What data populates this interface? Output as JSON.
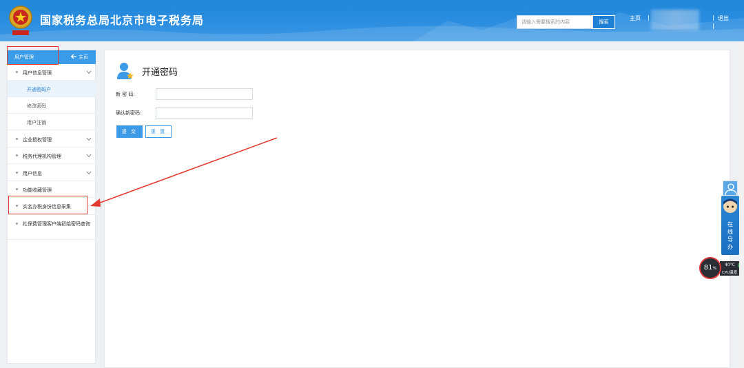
{
  "header": {
    "site_title": "国家税务总局北京市电子税务局",
    "search_placeholder": "请输入需要搜索的内容",
    "search_button": "搜索",
    "home_link": "主页",
    "separator": "|",
    "logout_link": "退出"
  },
  "sidebar": {
    "title": "用户管理",
    "home_link": "主页",
    "items": [
      {
        "label": "用户信息管理",
        "expandable": true
      },
      {
        "label": "开通密码户",
        "sub": true,
        "active": true
      },
      {
        "label": "修改密码",
        "sub": true
      },
      {
        "label": "用户注销",
        "sub": true
      },
      {
        "label": "企业授权管理",
        "expandable": true
      },
      {
        "label": "税务代理机构管理",
        "expandable": true
      },
      {
        "label": "用户信息",
        "expandable": true
      },
      {
        "label": "功能收藏管理",
        "expandable": false
      },
      {
        "label": "实名办税身份信息采集",
        "expandable": false
      },
      {
        "label": "社保费管理客户端初始密码查询",
        "expandable": false
      }
    ]
  },
  "main": {
    "page_title": "开通密码",
    "fields": [
      {
        "label": "新 密 码:",
        "value": ""
      },
      {
        "label": "确认新密码:",
        "value": ""
      }
    ],
    "submit_button": "提 交",
    "reset_button": "重 置"
  },
  "float": {
    "guide_text": "在线导办"
  },
  "cpu": {
    "usage": "81",
    "usage_unit": "%",
    "temp": "40°C",
    "label": "CPU温度"
  },
  "colors": {
    "header_bg": "#2a8de0",
    "sidebar_head": "#3a9be8",
    "annotation": "#e23b32",
    "accent": "#3d9ae6"
  }
}
